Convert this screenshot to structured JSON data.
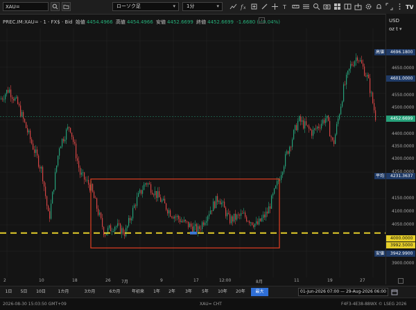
{
  "toolbar": {
    "symbol_value": "XAU=",
    "chart_type_label": "ローソク足",
    "interval_label": "1分"
  },
  "info": {
    "instrument": "PREC.IM:XAU= · 1 · FX$ · Bid",
    "open_label": "始値",
    "open_value": "4454.4966",
    "high_label": "高値",
    "high_value": "4454.4966",
    "low_label": "安値",
    "low_value": "4452.6699",
    "close_label": "終値",
    "close_value": "4452.6699",
    "change": "-1.6680 (−0.04%)"
  },
  "axis": {
    "currency": "USD",
    "unit": "oz t",
    "ticks": [
      "4650.0000",
      "4600.0000",
      "4550.0000",
      "4500.0000",
      "4450.0000",
      "4400.0000",
      "4350.0000",
      "4300.0000",
      "4250.0000",
      "4150.0000",
      "4100.0000",
      "4050.0000",
      "3900.0000"
    ]
  },
  "price_labels": {
    "high_name": "高値",
    "high_value": "4696.1800",
    "last_value": "4601.0000",
    "current_value": "4452.6699",
    "avg_name": "平均",
    "avg_value": "4231.3637",
    "level_value": "4000.0000",
    "level2_value": "3992.5000",
    "low_name": "安値",
    "low_value": "3942.9900"
  },
  "xaxis": {
    "ticks": [
      "2",
      "10",
      "18",
      "26",
      "7月",
      "9",
      "17",
      "12:00",
      "8月",
      "11",
      "19",
      "27"
    ]
  },
  "periods": [
    "1日",
    "5日",
    "10日",
    "1カ月",
    "3カ月",
    "6カ月",
    "年初来",
    "1年",
    "2年",
    "3年",
    "5年",
    "10年",
    "20年",
    "最大"
  ],
  "active_period": "最大",
  "date_range": "01-Jun-2026 07:00  —  29-Aug-2026 06:00",
  "status": {
    "timestamp": "2026-08-30 15:03:50 GMT+09",
    "center": "XAU= CHT",
    "right": "F4F3-4E38-88WX  © LSEG 2026"
  },
  "colors": {
    "up": "#26a17a",
    "down": "#d64545",
    "highlight_box": "#d23c22",
    "dashed_level": "#e6cf2a",
    "active": "#2f6fd6"
  }
}
